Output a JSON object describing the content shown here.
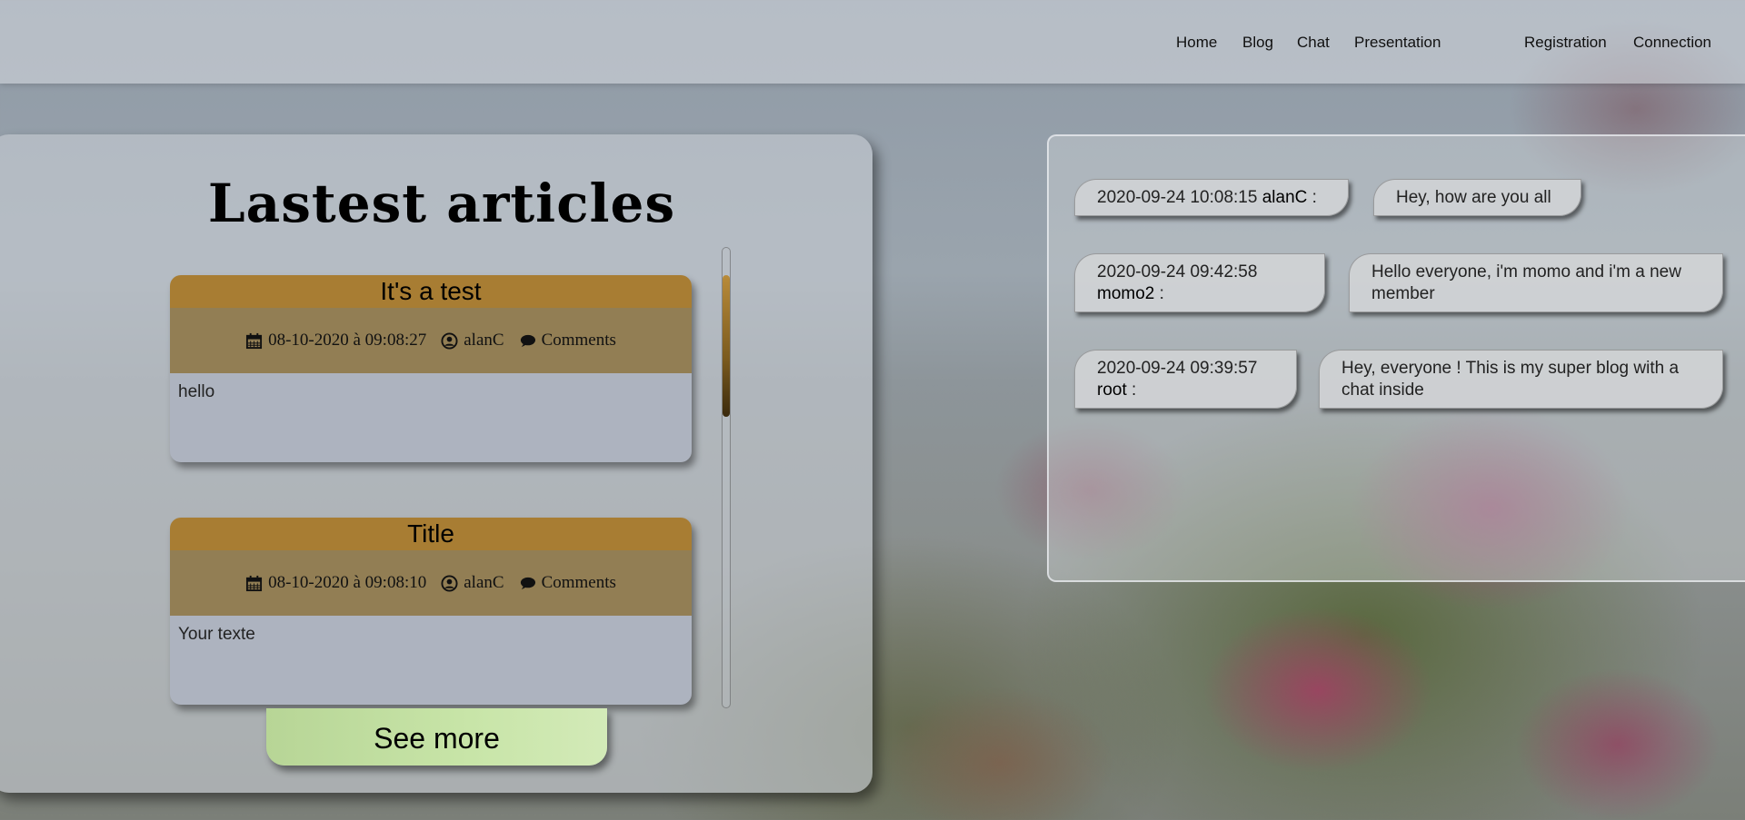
{
  "nav": {
    "links": [
      "Home",
      "Blog",
      "Chat",
      "Presentation"
    ],
    "right_links": [
      "Registration",
      "Connection"
    ]
  },
  "articles": {
    "title": "Lastest articles",
    "items": [
      {
        "title": "It's a test",
        "date": "08-10-2020 à 09:08:27",
        "author": "alanC",
        "comments_label": "Comments",
        "body": "hello"
      },
      {
        "title": "Title",
        "date": "08-10-2020 à 09:08:10",
        "author": "alanC",
        "comments_label": "Comments",
        "body": "Your texte"
      }
    ],
    "see_more": "See more"
  },
  "chat": {
    "messages": [
      {
        "timestamp": "2020-09-24 10:08:15",
        "user": "alanC",
        "sep": " :",
        "text": "Hey, how are you all"
      },
      {
        "timestamp": "2020-09-24 09:42:58",
        "user": "momo2",
        "sep": " :",
        "text": "Hello everyone, i'm momo and i'm a new member"
      },
      {
        "timestamp": "2020-09-24 09:39:57",
        "user": "root",
        "sep": " :",
        "text": "Hey, everyone ! This is my super blog with a chat inside"
      }
    ]
  },
  "colors": {
    "article_header": "#a87d33",
    "article_meta": "#8c733c",
    "see_more": "#c8e5a8"
  },
  "icons": [
    "calendar-icon",
    "user-circle-icon",
    "comment-icon"
  ]
}
